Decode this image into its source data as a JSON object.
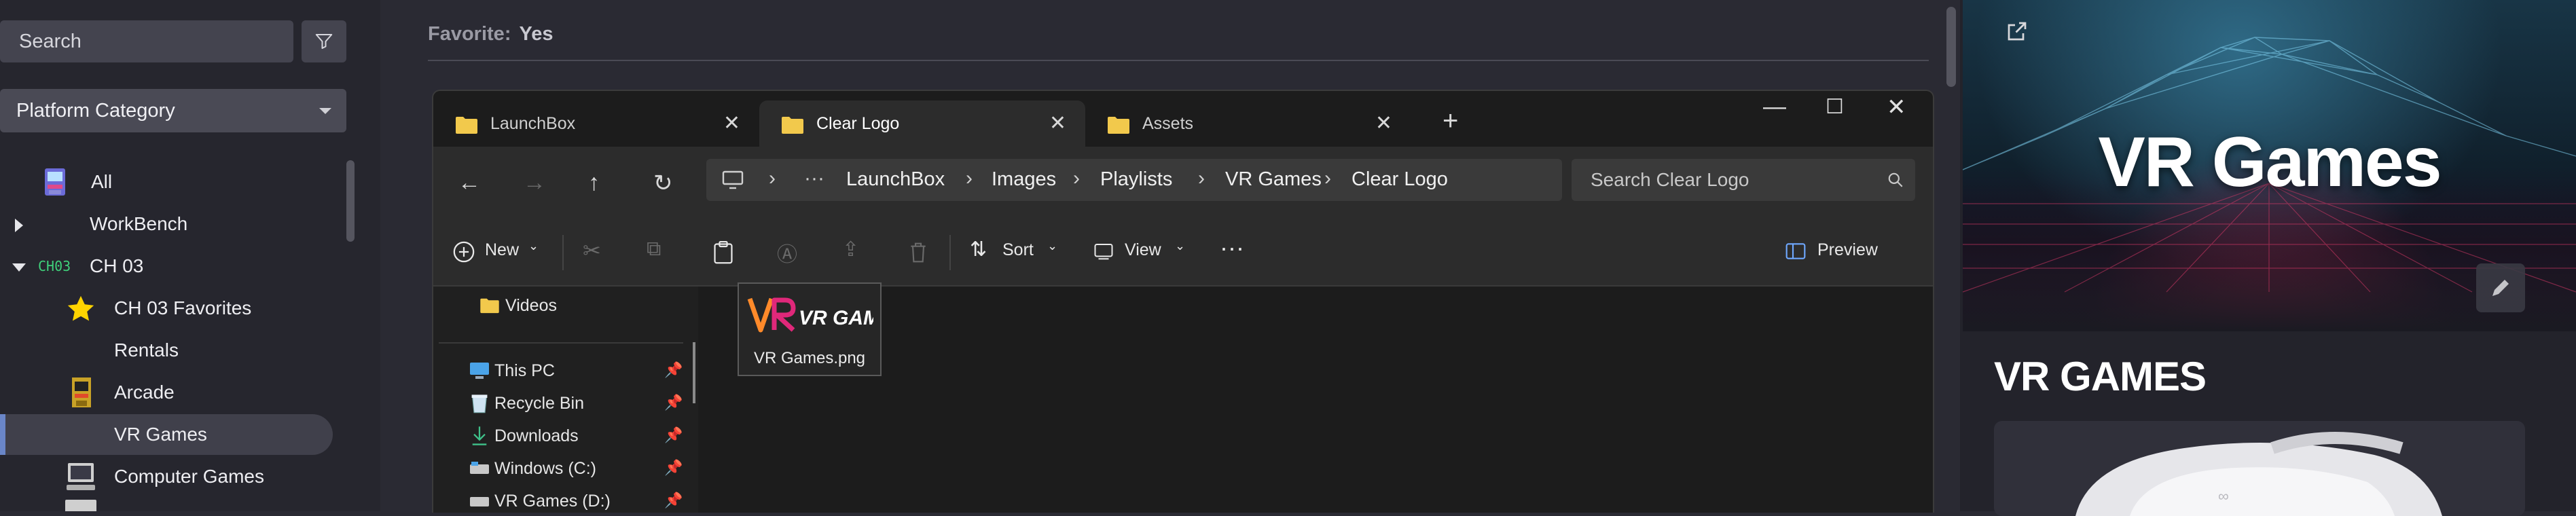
{
  "sidebar": {
    "search_placeholder": "Search",
    "category_dropdown": "Platform Category",
    "tree": [
      {
        "label": "All",
        "icon": "arcade-cabinet-icon"
      },
      {
        "label": "WorkBench",
        "expander": "collapsed"
      },
      {
        "label": "CH 03",
        "expander": "expanded",
        "badge": "CH03"
      },
      {
        "label": "CH 03 Favorites",
        "icon": "star-icon"
      },
      {
        "label": "Rentals"
      },
      {
        "label": "Arcade",
        "icon": "arcade-machine-icon"
      },
      {
        "label": "VR Games",
        "selected": true
      },
      {
        "label": "Computer Games",
        "icon": "computer-icon"
      }
    ]
  },
  "details": {
    "favorite_label": "Favorite:",
    "favorite_value": "Yes"
  },
  "explorer": {
    "tabs": [
      {
        "label": "LaunchBox"
      },
      {
        "label": "Clear Logo",
        "active": true
      },
      {
        "label": "Assets"
      }
    ],
    "breadcrumb": [
      "LaunchBox",
      "Images",
      "Playlists",
      "VR Games",
      "Clear Logo"
    ],
    "search_placeholder": "Search Clear Logo",
    "commands": {
      "new": "New",
      "sort": "Sort",
      "view": "View",
      "preview": "Preview"
    },
    "nav_pane": [
      {
        "label": "Videos",
        "icon": "folder-icon"
      },
      {
        "label": "This PC",
        "icon": "pc-icon",
        "pinned": true
      },
      {
        "label": "Recycle Bin",
        "icon": "recycle-bin-icon",
        "pinned": true
      },
      {
        "label": "Downloads",
        "icon": "download-icon",
        "pinned": true
      },
      {
        "label": "Windows (C:)",
        "icon": "drive-icon",
        "pinned": true
      },
      {
        "label": "VR Games (D:)",
        "icon": "drive-icon",
        "pinned": true
      }
    ],
    "files": [
      {
        "name": "VR Games.png",
        "logo_text": "VR GAMES"
      }
    ]
  },
  "right_panel": {
    "banner_title": "VR Games",
    "section_title": "VR GAMES"
  },
  "colors": {
    "accent": "#6a86c8",
    "folder": "#f2c94c",
    "logo_orange": "#ff8a2a",
    "logo_pink": "#e0287a"
  }
}
